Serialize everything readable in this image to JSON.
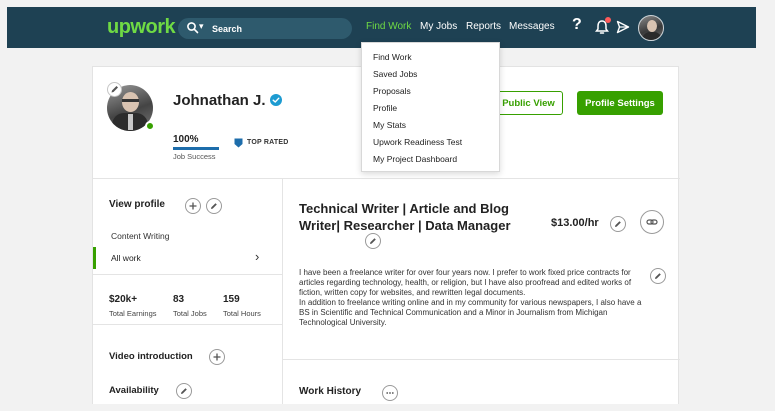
{
  "header": {
    "logo": "upwork",
    "search_placeholder": "Search",
    "nav": [
      "Find Work",
      "My Jobs",
      "Reports",
      "Messages"
    ],
    "help": "?"
  },
  "dropdown": {
    "items": [
      "Find Work",
      "Saved Jobs",
      "Proposals",
      "Profile",
      "My Stats",
      "Upwork Readiness Test",
      "My Project Dashboard"
    ]
  },
  "profile": {
    "name": "Johnathan J.",
    "job_success_value": "100%",
    "job_success_fraction": 1.0,
    "job_success_label": "Job Success",
    "badge_label": "TOP RATED",
    "public_view_label": "Public View",
    "settings_label": "Profile Settings"
  },
  "sidebar": {
    "view_profile": "View profile",
    "content_writing": "Content Writing",
    "all_work": "All work",
    "stats": [
      {
        "value": "$20k+",
        "label": "Total Earnings"
      },
      {
        "value": "83",
        "label": "Total Jobs"
      },
      {
        "value": "159",
        "label": "Total Hours"
      }
    ],
    "video_intro": "Video introduction",
    "availability": "Availability"
  },
  "main": {
    "title": "Technical Writer | Article and Blog Writer| Researcher | Data Manager",
    "rate": "$13.00/hr",
    "overview_p1": "I have been a freelance writer for over four years now. I prefer to work fixed price contracts for articles regarding technology, health, or religion, but I have also proofread and edited works of fiction, written copy for websites, and rewritten legal documents.",
    "overview_p2": "In addition to freelance writing online and in my community for various newspapers, I also have a BS in Scientific and Technical Communication and a Minor in Journalism from Michigan Technological University.",
    "work_history": "Work History"
  },
  "colors": {
    "header_bg": "#1e4153",
    "brand_green": "#37a000",
    "logo_green": "#6fda44",
    "active_nav": "#6fda44"
  }
}
